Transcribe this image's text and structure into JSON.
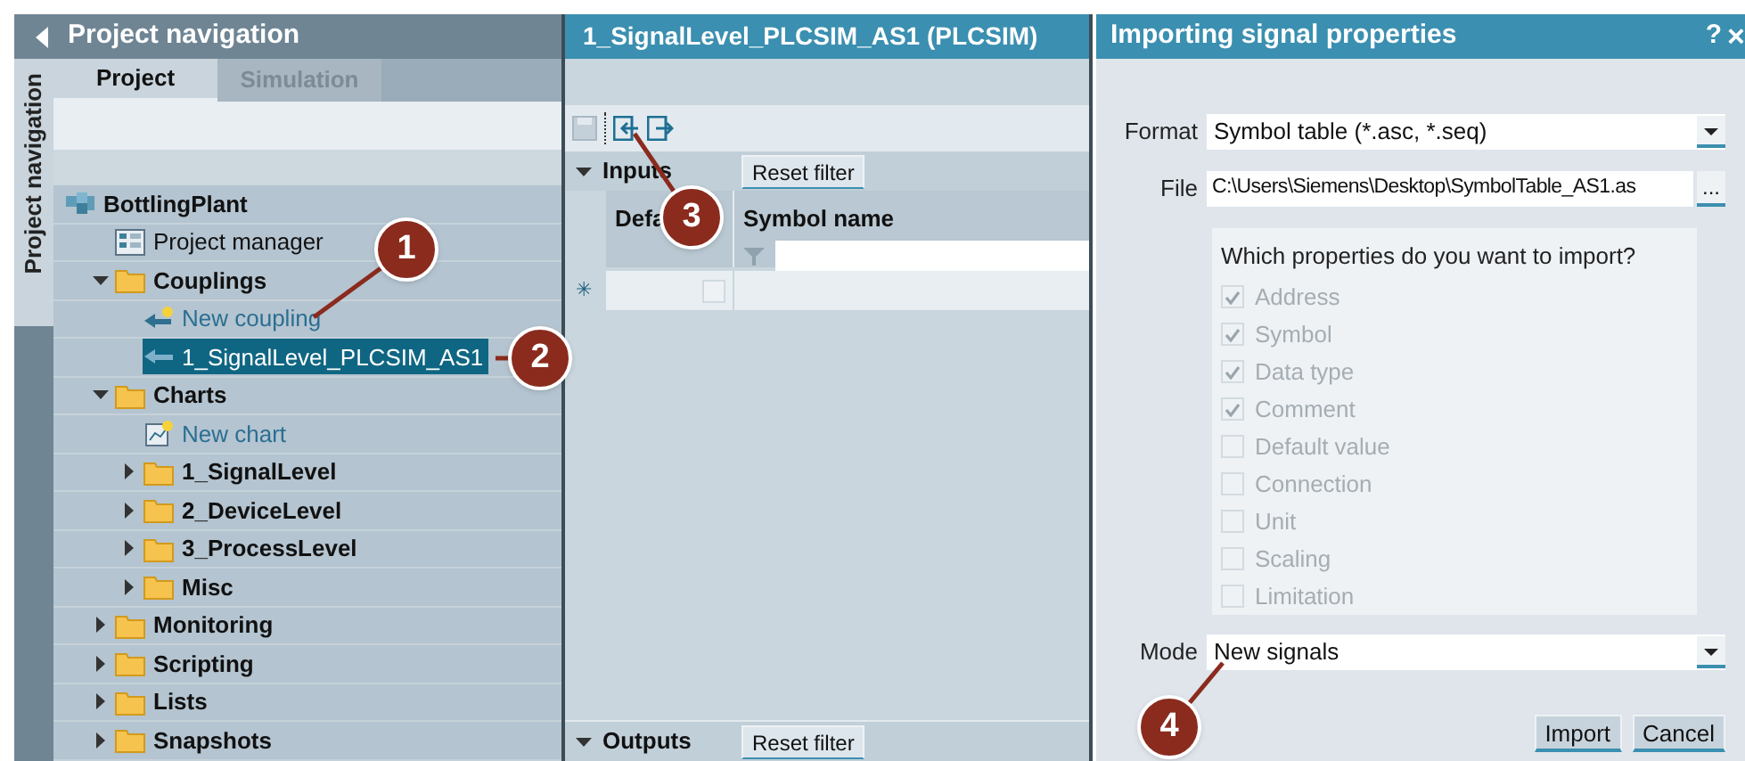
{
  "side_tab": {
    "label": "Project navigation"
  },
  "project_navigation": {
    "title": "Project navigation",
    "tabs": [
      {
        "label": "Project",
        "selected": true
      },
      {
        "label": "Simulation",
        "selected": false
      }
    ],
    "tree": [
      {
        "label": "BottlingPlant",
        "kind": "root",
        "selected": false,
        "children": [
          {
            "label": "Project manager",
            "kind": "tool",
            "selected": false
          },
          {
            "label": "Couplings",
            "kind": "folder",
            "expanded": true,
            "selected": false,
            "children": [
              {
                "label": "New coupling",
                "kind": "new-coupling",
                "selected": false
              },
              {
                "label": "1_SignalLevel_PLCSIM_AS1",
                "kind": "coupling",
                "selected": true
              }
            ]
          },
          {
            "label": "Charts",
            "kind": "folder",
            "expanded": true,
            "selected": false,
            "children": [
              {
                "label": "New chart",
                "kind": "new-chart",
                "selected": false
              },
              {
                "label": "1_SignalLevel",
                "kind": "folder",
                "expanded": false,
                "selected": false
              },
              {
                "label": "2_DeviceLevel",
                "kind": "folder",
                "expanded": false,
                "selected": false
              },
              {
                "label": "3_ProcessLevel",
                "kind": "folder",
                "expanded": false,
                "selected": false
              },
              {
                "label": "Misc",
                "kind": "folder",
                "expanded": false,
                "selected": false
              }
            ]
          },
          {
            "label": "Monitoring",
            "kind": "folder",
            "expanded": false,
            "selected": false
          },
          {
            "label": "Scripting",
            "kind": "folder",
            "expanded": false,
            "selected": false
          },
          {
            "label": "Lists",
            "kind": "folder",
            "expanded": false,
            "selected": false
          },
          {
            "label": "Snapshots",
            "kind": "folder",
            "expanded": false,
            "selected": false
          }
        ]
      }
    ]
  },
  "editor": {
    "title": "1_SignalLevel_PLCSIM_AS1 (PLCSIM)",
    "inputs": {
      "label": "Inputs",
      "expanded": true,
      "reset_button": "Reset filter",
      "columns": [
        "Defa",
        "Symbol name"
      ],
      "new_row_marker": "✳",
      "new_row_checked": false
    },
    "outputs": {
      "label": "Outputs",
      "expanded": true,
      "reset_button": "Reset filter"
    }
  },
  "dialog": {
    "title": "Importing signal properties",
    "help": "?",
    "close": "×",
    "format": {
      "label": "Format",
      "value": "Symbol table (*.asc, *.seq)"
    },
    "file": {
      "label": "File",
      "value": "C:\\Users\\Siemens\\Desktop\\SymbolTable_AS1.as",
      "browse": "..."
    },
    "properties": {
      "question": "Which properties do you want to import?",
      "items": [
        {
          "label": "Address",
          "checked": true,
          "disabled": true
        },
        {
          "label": "Symbol",
          "checked": true,
          "disabled": true
        },
        {
          "label": "Data type",
          "checked": true,
          "disabled": true
        },
        {
          "label": "Comment",
          "checked": true,
          "disabled": true
        },
        {
          "label": "Default value",
          "checked": false,
          "disabled": true
        },
        {
          "label": "Connection",
          "checked": false,
          "disabled": true
        },
        {
          "label": "Unit",
          "checked": false,
          "disabled": true
        },
        {
          "label": "Scaling",
          "checked": false,
          "disabled": true
        },
        {
          "label": "Limitation",
          "checked": false,
          "disabled": true
        }
      ]
    },
    "mode": {
      "label": "Mode",
      "value": "New signals"
    },
    "buttons": [
      "Import",
      "Cancel"
    ]
  },
  "callouts": [
    "1",
    "2",
    "3",
    "4"
  ]
}
